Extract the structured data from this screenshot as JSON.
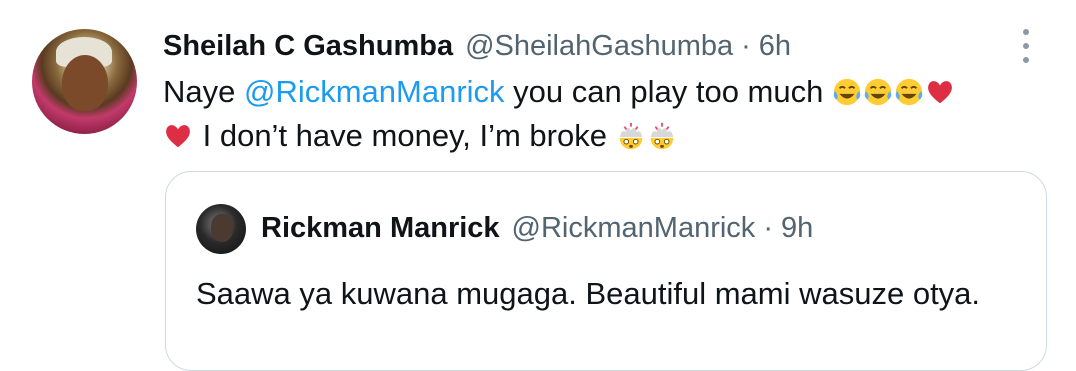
{
  "tweet": {
    "display_name": "Sheilah C Gashumba",
    "handle": "@SheilahGashumba",
    "separator": "·",
    "time": "6h",
    "text_part1": "Naye ",
    "mention": "@RickmanManrick",
    "text_part2": " you can play too much ",
    "text_part3": " I don’t have money, I’m broke ",
    "emojis": [
      "face-with-tears-of-joy",
      "face-with-tears-of-joy",
      "face-with-tears-of-joy",
      "red-heart",
      "red-heart",
      "exploding-head",
      "exploding-head"
    ]
  },
  "quoted_tweet": {
    "display_name": "Rickman Manrick",
    "handle": "@RickmanManrick",
    "separator": "·",
    "time": "9h",
    "text": "Saawa ya kuwana mugaga. Beautiful mami wasuze otya."
  },
  "colors": {
    "text": "#0f1419",
    "secondary": "#536471",
    "link": "#1d9bf0",
    "border": "#cfd9de"
  }
}
